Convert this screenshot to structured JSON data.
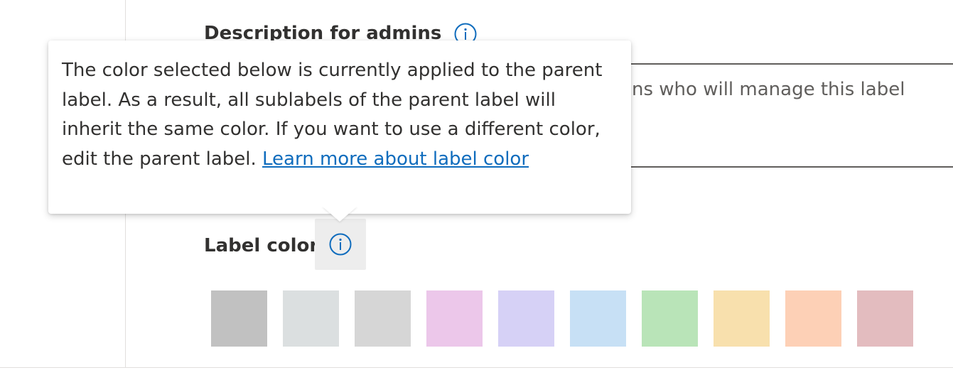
{
  "description_section": {
    "label": "Description for admins",
    "info_icon": "info-icon",
    "placeholder": "ns who will manage this label"
  },
  "label_color_section": {
    "label": "Label color",
    "info_icon": "info-icon",
    "swatches": [
      {
        "name": "gray",
        "color": "#c1c1c1"
      },
      {
        "name": "light-gray-blue",
        "color": "#dbdfe0"
      },
      {
        "name": "light-gray",
        "color": "#d6d6d6"
      },
      {
        "name": "pink",
        "color": "#ecc7ea"
      },
      {
        "name": "lavender",
        "color": "#d6d1f6"
      },
      {
        "name": "light-blue",
        "color": "#c7e0f5"
      },
      {
        "name": "green",
        "color": "#b9e4b8"
      },
      {
        "name": "yellow",
        "color": "#f8e0ad"
      },
      {
        "name": "peach",
        "color": "#fdd0b6"
      },
      {
        "name": "rose",
        "color": "#e3bcbf"
      }
    ]
  },
  "tooltip": {
    "text": "The color selected below is currently applied to the parent label. As a result, all sublabels of the parent label will inherit the same color. If you want to use a different color, edit the parent label. ",
    "link_text": "Learn more about label color"
  },
  "colors": {
    "accent": "#0f6cbd",
    "text": "#323130",
    "divider": "#e1dfdd"
  }
}
